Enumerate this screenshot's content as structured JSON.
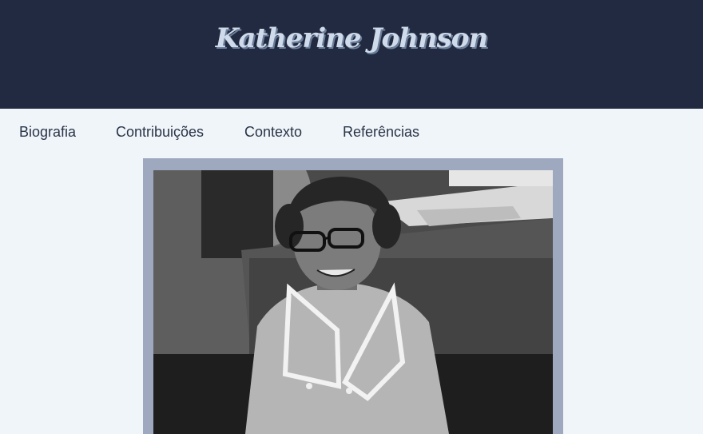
{
  "header": {
    "title": "Katherine Johnson"
  },
  "nav": {
    "items": [
      {
        "label": "Biografia"
      },
      {
        "label": "Contribuições"
      },
      {
        "label": "Contexto"
      },
      {
        "label": "Referências"
      }
    ]
  },
  "colors": {
    "header_bg": "#212a40",
    "page_bg": "#f0f5f9",
    "frame": "#9ea9bf",
    "nav_text": "#2b3548"
  }
}
